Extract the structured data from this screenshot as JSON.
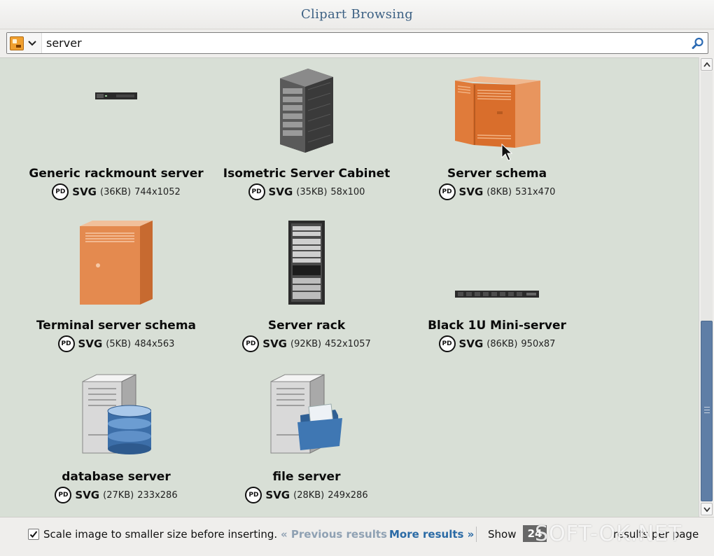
{
  "window": {
    "title": "Clipart Browsing"
  },
  "search": {
    "value": "server",
    "placeholder": ""
  },
  "results": [
    {
      "title": "Generic rackmount server",
      "license": "PD",
      "format": "SVG",
      "size": "(36KB)",
      "dims": "744x1052",
      "icon": "rackmount-server-thumbnail"
    },
    {
      "title": "Isometric Server Cabinet",
      "license": "PD",
      "format": "SVG",
      "size": "(35KB)",
      "dims": "58x100",
      "icon": "server-cabinet-thumbnail"
    },
    {
      "title": "Server schema",
      "license": "PD",
      "format": "SVG",
      "size": "(8KB)",
      "dims": "531x470",
      "icon": "server-schema-thumbnail"
    },
    {
      "title": "Terminal server schema",
      "license": "PD",
      "format": "SVG",
      "size": "(5KB)",
      "dims": "484x563",
      "icon": "terminal-server-thumbnail"
    },
    {
      "title": "Server rack",
      "license": "PD",
      "format": "SVG",
      "size": "(92KB)",
      "dims": "452x1057",
      "icon": "server-rack-thumbnail"
    },
    {
      "title": "Black 1U Mini-server",
      "license": "PD",
      "format": "SVG",
      "size": "(86KB)",
      "dims": "950x87",
      "icon": "mini-server-thumbnail"
    },
    {
      "title": "database server",
      "license": "PD",
      "format": "SVG",
      "size": "(27KB)",
      "dims": "233x286",
      "icon": "database-server-thumbnail"
    },
    {
      "title": "file server",
      "license": "PD",
      "format": "SVG",
      "size": "(28KB)",
      "dims": "249x286",
      "icon": "file-server-thumbnail"
    }
  ],
  "footer": {
    "scale_label": "Scale image to smaller size before inserting.",
    "scale_checked": true,
    "prev_label": "« Previous results",
    "more_label": "More results »",
    "show_label": "Show",
    "per_page_value": "24",
    "per_page_suffix": "results per page"
  },
  "watermark": "SOFT-OK.NET",
  "colors": {
    "title": "#3d6184",
    "content_bg": "#d8dfd6",
    "link": "#2a6aa5",
    "link_disabled": "#8fa1b3",
    "scroll_thumb": "#5f7ea6"
  }
}
